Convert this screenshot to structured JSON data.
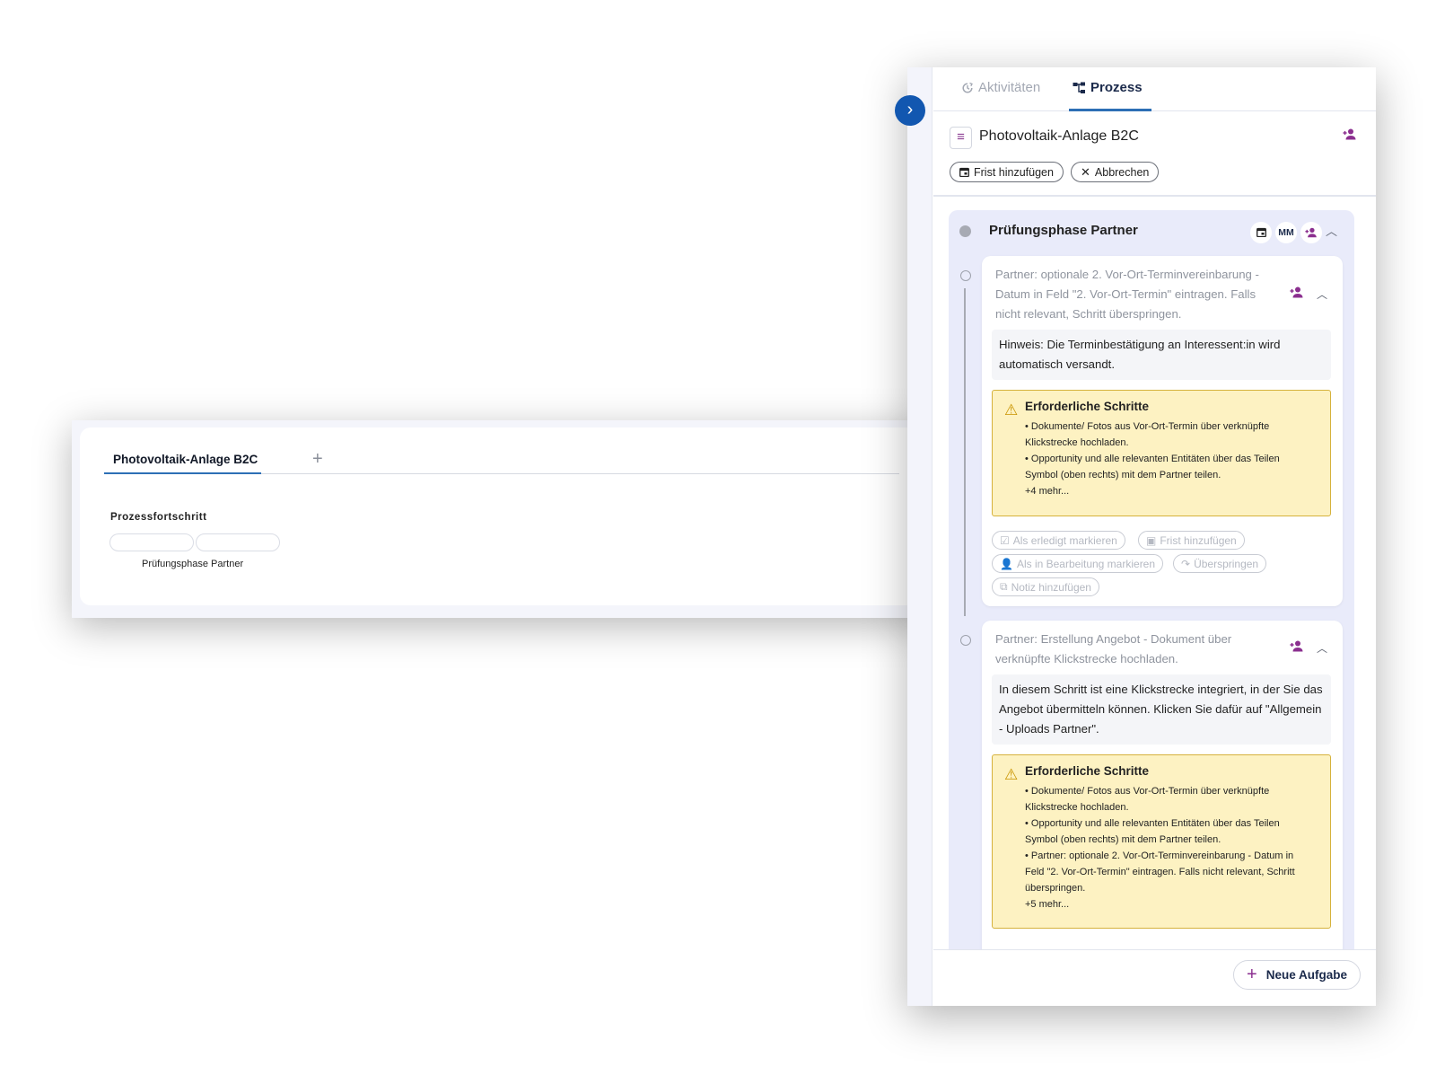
{
  "left_card": {
    "tab_label": "Photovoltaik-Anlage B2C",
    "add_tab_icon": "+",
    "progress_label": "Prozessfortschritt",
    "progress_phase": "Prüfungsphase Partner"
  },
  "panel": {
    "collapse_icon": "›",
    "tabs": [
      {
        "label": "Aktivitäten",
        "icon": "activity-icon",
        "active": false
      },
      {
        "label": "Prozess",
        "icon": "process-icon",
        "active": true
      }
    ],
    "title": "Photovoltaik-Anlage B2C",
    "chips": {
      "add_deadline": "Frist hinzufügen",
      "cancel": "Abbrechen"
    },
    "phase": {
      "title": "Prüfungsphase Partner",
      "initials": "MM"
    },
    "tasks": [
      {
        "title": "Partner: optionale 2. Vor-Ort-Terminvereinbarung - Datum in Feld \"2. Vor-Ort-Termin\" eintragen. Falls nicht relevant, Schritt überspringen.",
        "note": "Hinweis: Die Terminbestätigung an Interessent:in wird automatisch versandt.",
        "required_title": "Erforderliche Schritte",
        "required_lines": [
          "• Dokumente/ Fotos aus Vor-Ort-Termin über verknüpfte",
          "Klickstrecke hochladen.",
          "• Opportunity und alle relevanten Entitäten über das Teilen",
          "Symbol (oben rechts) mit dem Partner teilen.",
          "+4 mehr..."
        ],
        "actions": {
          "mark_done": "Als erledigt markieren",
          "add_deadline": "Frist hinzufügen",
          "mark_in_progress": "Als in Bearbeitung markieren",
          "skip": "Überspringen",
          "add_note": "Notiz hinzufügen"
        }
      },
      {
        "title": "Partner: Erstellung Angebot - Dokument über verknüpfte Klickstrecke hochladen.",
        "note": "In diesem Schritt ist eine Klickstrecke integriert, in der Sie das Angebot übermitteln können. Klicken Sie dafür auf \"Allgemein - Uploads Partner\".",
        "required_title": "Erforderliche Schritte",
        "required_lines": [
          "• Dokumente/ Fotos aus Vor-Ort-Termin über verknüpfte",
          "Klickstrecke hochladen.",
          "• Opportunity und alle relevanten Entitäten über das Teilen",
          "Symbol (oben rechts) mit dem Partner teilen.",
          "• Partner: optionale 2. Vor-Ort-Terminvereinbarung - Datum in",
          "Feld \"2. Vor-Ort-Termin\" eintragen. Falls nicht relevant, Schritt",
          "überspringen.",
          "+5 mehr..."
        ]
      }
    ],
    "new_task": "Neue Aufgabe"
  },
  "colors": {
    "accent_blue": "#1257b0",
    "tab_underline": "#2d6fb5",
    "purple_icon": "#8b2f8f",
    "phase_bg": "#e9ebfa",
    "warning_bg": "#fdf2c2",
    "warning_border": "#d6b23c"
  }
}
